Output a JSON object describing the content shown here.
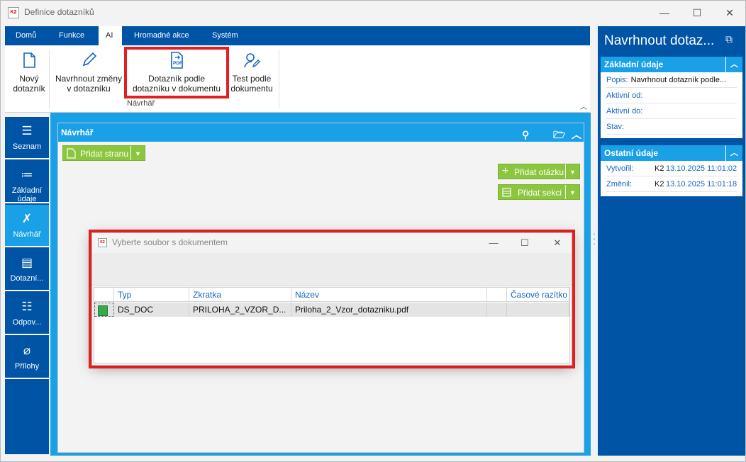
{
  "window": {
    "title": "Definice dotazníků",
    "logo": "K2",
    "controls": {
      "minimize": "—",
      "maximize": "☐",
      "close": "✕"
    }
  },
  "ribbon": {
    "tabs": [
      {
        "label": "Domů",
        "active": false
      },
      {
        "label": "Funkce",
        "active": false
      },
      {
        "label": "AI",
        "active": true
      },
      {
        "label": "Hromadné akce",
        "active": false
      },
      {
        "label": "Systém",
        "active": false
      }
    ],
    "buttons": [
      {
        "line1": "Nový",
        "line2": "dotazník",
        "icon": "new-document-icon"
      },
      {
        "line1": "Navrhnout změny",
        "line2": "v dotazníku",
        "icon": "pencil-icon"
      },
      {
        "line1": "Dotazník podle",
        "line2": "dotazníku v dokumentu",
        "icon": "pdf-icon"
      },
      {
        "line1": "Test podle",
        "line2": "dokumentu",
        "icon": "user-edit-icon"
      }
    ],
    "group_label": "Návrhář"
  },
  "leftnav": [
    {
      "label1": "Seznam",
      "label2": "",
      "icon": "list-icon",
      "active": false
    },
    {
      "label1": "Základní",
      "label2": "údaje",
      "icon": "bullet-list-icon",
      "active": false
    },
    {
      "label1": "Návrhář",
      "label2": "",
      "icon": "tools-icon",
      "active": true
    },
    {
      "label1": "Dotazní...",
      "label2": "",
      "icon": "clipboard-icon",
      "active": false
    },
    {
      "label1": "Odpov...",
      "label2": "",
      "icon": "checklist-icon",
      "active": false
    },
    {
      "label1": "Přílohy",
      "label2": "",
      "icon": "paperclip-icon",
      "active": false
    }
  ],
  "main": {
    "header": "Návrhář",
    "add_page": "Přidat stranu",
    "add_question": "Přidat otázku",
    "add_section": "Přidat sekci"
  },
  "right_panel": {
    "title": "Navrhnout dotaz...",
    "basic": {
      "header": "Základní údaje",
      "rows": [
        {
          "label": "Popis:",
          "value": "Navrhnout dotazník podle..."
        },
        {
          "label": "Aktivní od:",
          "value": ""
        },
        {
          "label": "Aktivní do:",
          "value": ""
        },
        {
          "label": "Stav:",
          "value": ""
        }
      ]
    },
    "other": {
      "header": "Ostatní údaje",
      "rows": [
        {
          "label": "Vytvořil:",
          "user": "K2",
          "date": "13.10.2025 11:01:02"
        },
        {
          "label": "Změnil:",
          "user": "K2",
          "date": "13.10.2025 11:01:18"
        }
      ]
    }
  },
  "dialog": {
    "title": "Vyberte soubor s dokumentem",
    "columns": [
      "Typ",
      "Zkratka",
      "Název",
      "",
      "Časové razítko"
    ],
    "rows": [
      {
        "typ": "DS_DOC",
        "zkratka": "PRILOHA_2_VZOR_D...",
        "nazev": "Priloha_2_Vzor_dotazniku.pdf",
        "blank": "",
        "razitko": ""
      }
    ]
  },
  "colors": {
    "dark_blue": "#0054a6",
    "light_blue": "#19a0e6",
    "green": "#8cc63f",
    "highlight_red": "#e02020"
  }
}
